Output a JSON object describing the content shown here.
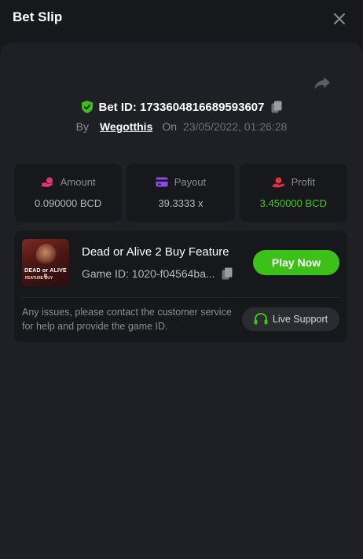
{
  "header": {
    "title": "Bet Slip"
  },
  "bet": {
    "id_text": "Bet ID: 1733604816689593607",
    "by_label": "By",
    "user": "Wegotthis",
    "on_label": "On",
    "datetime": "23/05/2022, 01:26:28"
  },
  "stats": [
    {
      "label": "Amount",
      "value": "0.090000 BCD",
      "icon": "hand-coin-icon"
    },
    {
      "label": "Payout",
      "value": "39.3333 x",
      "icon": "card-icon"
    },
    {
      "label": "Profit",
      "value": "3.450000 BCD",
      "icon": "profit-hand-icon"
    }
  ],
  "game": {
    "name": "Dead or Alive 2 Buy Feature",
    "id_text": "Game ID: 1020-f04564ba...",
    "thumb_title": "DEAD or ALIVE II",
    "thumb_sub": "FEATURE BUY",
    "play_label": "Play Now"
  },
  "support": {
    "text": "Any issues, please contact the customer service for help and provide the game ID.",
    "button_label": "Live Support"
  },
  "colors": {
    "accent_green": "#3bc117",
    "profit_green": "#43c91c",
    "amount_pink": "#e0356f",
    "payout_purple": "#8a4be8",
    "profit_red": "#e0323f"
  }
}
